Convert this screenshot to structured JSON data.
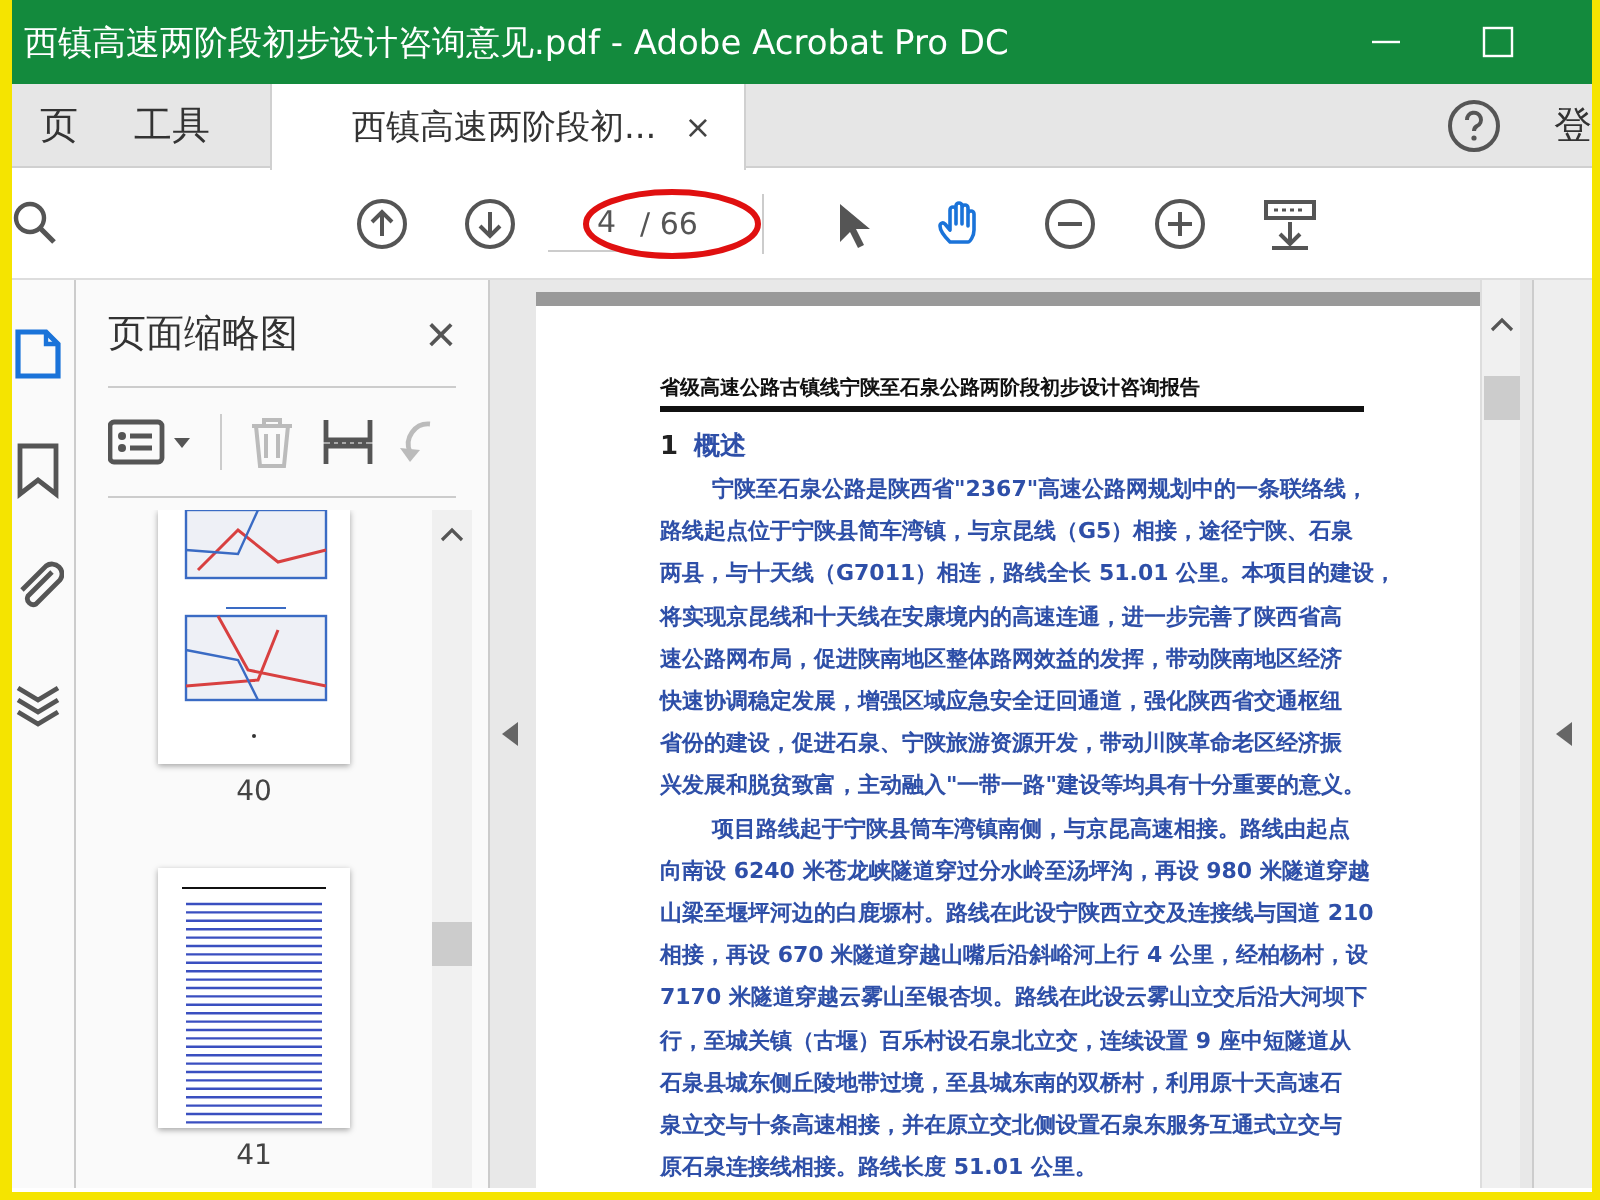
{
  "window": {
    "title": "西镇高速两阶段初步设计咨询意见.pdf - Adobe Acrobat Pro DC"
  },
  "tabs": [
    {
      "label": "页",
      "selected": false,
      "closable": false
    },
    {
      "label": "工具",
      "selected": false,
      "closable": false
    },
    {
      "label": "西镇高速两阶段初...",
      "selected": true,
      "closable": true
    }
  ],
  "tab_close": "×",
  "sign_in": "登",
  "toolbar": {
    "page_number": "4",
    "page_total": "/ 66",
    "tools": [
      {
        "kind": "select",
        "selected": false
      },
      {
        "kind": "hand",
        "selected": true
      },
      {
        "kind": "zoom-out",
        "selected": false
      },
      {
        "kind": "zoom-in",
        "selected": false
      },
      {
        "kind": "scroll-mode",
        "selected": false
      }
    ]
  },
  "left_rail": [
    {
      "kind": "pages",
      "selected": true
    },
    {
      "kind": "bookmark",
      "selected": false
    },
    {
      "kind": "attachment",
      "selected": false
    },
    {
      "kind": "layers",
      "selected": false
    }
  ],
  "thumbnail_panel": {
    "title": "页面缩略图",
    "close": "×",
    "tools": [
      {
        "kind": "options",
        "disabled": false
      },
      {
        "kind": "delete",
        "disabled": true
      },
      {
        "kind": "insert",
        "disabled": false
      },
      {
        "kind": "rotate",
        "disabled": true
      }
    ],
    "pages": [
      {
        "label": "40",
        "kind": "maps"
      },
      {
        "label": "41",
        "kind": "text"
      }
    ]
  },
  "document": {
    "header": "省级高速公路古镇线宁陕至石泉公路两阶段初步设计咨询报告",
    "heading_number": "1",
    "heading": "概述",
    "paragraphs": [
      {
        "lines": [
          "宁陕至石泉公路是陕西省\"2367\"高速公路网规划中的一条联络线，",
          "路线起点位于宁陕县简车湾镇，与京昆线（G5）相接，途径宁陕、石泉",
          "两县，与十天线（G7011）相连，路线全长 51.01 公里。本项目的建设，",
          "将实现京昆线和十天线在安康境内的高速连通，进一步完善了陕西省高",
          "速公路网布局，促进陕南地区整体路网效益的发挥，带动陕南地区经济",
          "快速协调稳定发展，增强区域应急安全迂回通道，强化陕西省交通枢纽",
          "省份的建设，促进石泉、宁陕旅游资源开发，带动川陕革命老区经济振",
          "兴发展和脱贫致富，主动融入\"一带一路\"建设等均具有十分重要的意义。"
        ]
      },
      {
        "lines": [
          "项目路线起于宁陕县筒车湾镇南侧，与京昆高速相接。路线由起点",
          "向南设 6240 米苍龙峡隧道穿过分水岭至汤坪沟，再设 980 米隧道穿越",
          "山梁至堰坪河边的白鹿塬村。路线在此设宁陕西立交及连接线与国道 210",
          "相接，再设 670 米隧道穿越山嘴后沿斜峪河上行 4 公里，经柏杨村，设",
          "7170 米隧道穿越云雾山至银杏坝。路线在此设云雾山立交后沿大河坝下",
          "行，至城关镇（古堰）百乐村设石泉北立交，连续设置 9 座中短隧道从",
          "石泉县城东侧丘陵地带过境，至县城东南的双桥村，利用原十天高速石",
          "泉立交与十条高速相接，并在原立交北侧设置石泉东服务互通式立交与",
          "原石泉连接线相接。路线长度 51.01 公里。"
        ]
      }
    ]
  }
}
